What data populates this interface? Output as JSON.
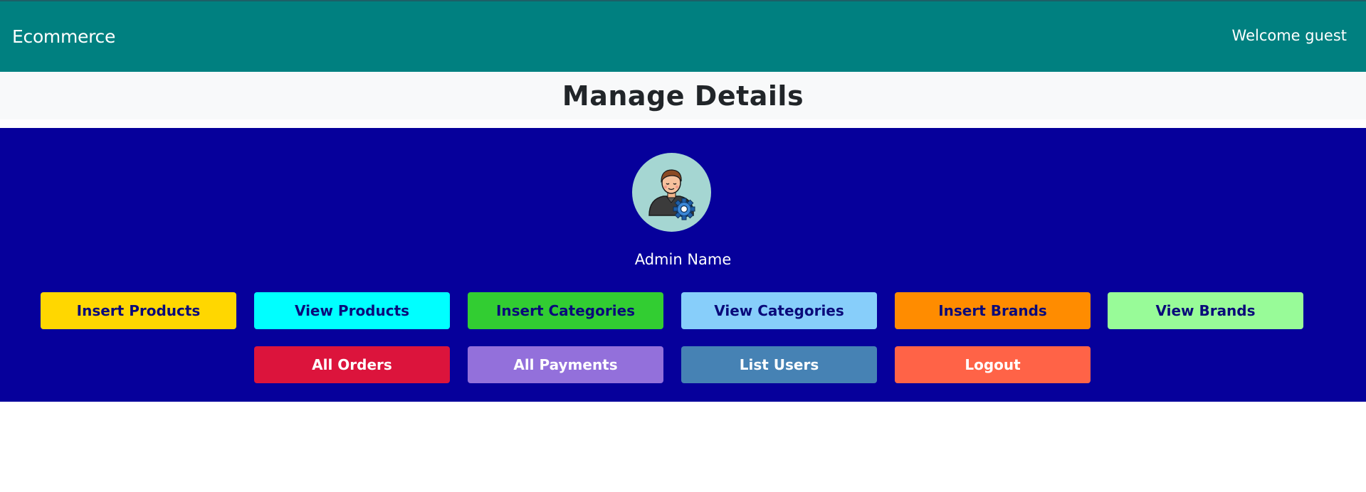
{
  "navbar": {
    "brand": "Ecommerce",
    "welcome": "Welcome guest"
  },
  "page_title": "Manage Details",
  "admin": {
    "name": "Admin Name",
    "avatar_icon": "admin-settings-icon"
  },
  "buttons_row1": [
    {
      "label": "Insert Products",
      "color": "#ffd700"
    },
    {
      "label": "View Products",
      "color": "#00ffff"
    },
    {
      "label": "Insert Categories",
      "color": "#32cd32"
    },
    {
      "label": "View Categories",
      "color": "#87cefa"
    },
    {
      "label": "Insert Brands",
      "color": "#ff8c00"
    },
    {
      "label": "View Brands",
      "color": "#98fb98"
    }
  ],
  "buttons_row2": [
    {
      "label": "All Orders",
      "color": "#dc143c"
    },
    {
      "label": "All Payments",
      "color": "#9370db"
    },
    {
      "label": "List Users",
      "color": "#4682b4"
    },
    {
      "label": "Logout",
      "color": "#ff6347"
    }
  ],
  "colors": {
    "navbar": "#008080",
    "panel": "#06009b",
    "title_bg": "#f8f9fa"
  }
}
